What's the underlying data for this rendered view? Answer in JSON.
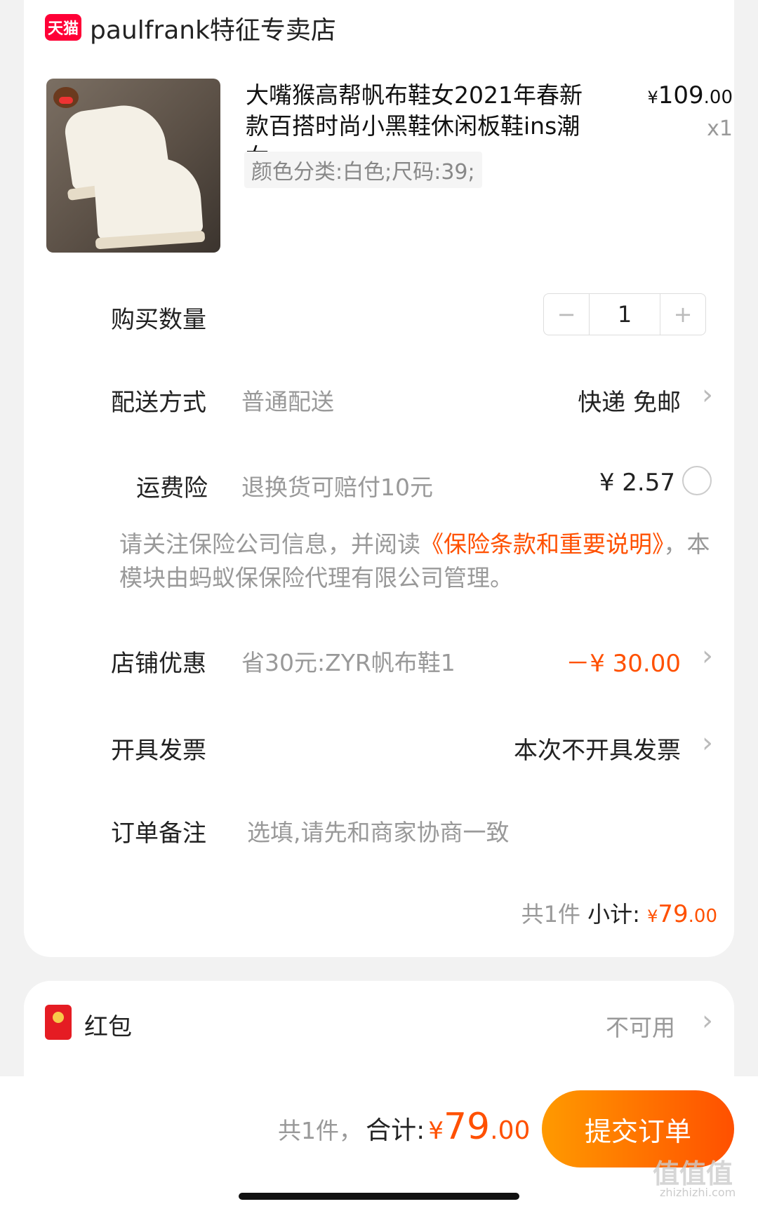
{
  "store": {
    "badge": "天猫",
    "name": "paulfrank特征专卖店"
  },
  "product": {
    "title": "大嘴猴高帮帆布鞋女2021年春新款百搭时尚小黑鞋休闲板鞋ins潮女",
    "price_main": "109",
    "price_cents": ".00",
    "currency": "¥",
    "qty": "x1",
    "sku": "颜色分类:白色;尺码:39;"
  },
  "quantity": {
    "label": "购买数量",
    "minus": "−",
    "value": "1",
    "plus": "+"
  },
  "delivery": {
    "label": "配送方式",
    "sub": "普通配送",
    "value": "快递 免邮"
  },
  "insurance": {
    "label": "运费险",
    "sub": "退换货可赔付10元",
    "value": "¥ 2.57"
  },
  "notice": {
    "prefix": "请关注保险公司信息，并阅读",
    "link": "《保险条款和重要说明》",
    "suffix": "，本模块由蚂蚁保保险代理有限公司管理。"
  },
  "store_discount": {
    "label": "店铺优惠",
    "sub": "省30元:ZYR帆布鞋1",
    "value": "－¥ 30.00"
  },
  "invoice": {
    "label": "开具发票",
    "value": "本次不开具发票"
  },
  "remark": {
    "label": "订单备注",
    "placeholder": "选填,请先和商家协商一致"
  },
  "subtotal": {
    "count": "共1件",
    "label": "小计:",
    "currency": "¥",
    "main": "79",
    "cents": ".00"
  },
  "red_packet": {
    "label": "红包",
    "value": "不可用"
  },
  "footer": {
    "count": "共1件，",
    "label": "合计:",
    "currency": "¥",
    "main": "79",
    "cents": ".00",
    "submit": "提交订单"
  },
  "watermark": {
    "main": "值值值",
    "sub": "zhizhizhi.com"
  },
  "colors": {
    "accent": "#ff5000",
    "tmall": "#ff0036"
  },
  "icons": [
    "tmall-icon",
    "chevron-right-icon",
    "radio-unchecked-icon",
    "red-packet-icon"
  ]
}
